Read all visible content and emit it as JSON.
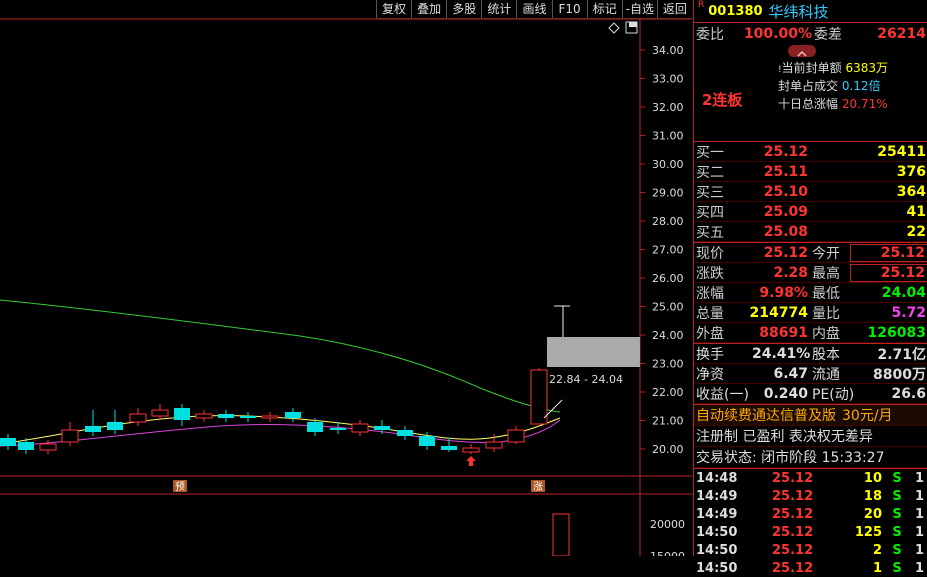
{
  "toolbar": [
    "复权",
    "叠加",
    "多股",
    "统计",
    "画线",
    "F10",
    "标记",
    "-自选",
    "返回"
  ],
  "chart": {
    "price_axis": [
      "34.00",
      "33.00",
      "32.00",
      "31.00",
      "30.00",
      "29.00",
      "28.00",
      "27.00",
      "26.00",
      "25.00",
      "24.00",
      "23.00",
      "22.00",
      "21.00",
      "20.00"
    ],
    "range_label": "22.84 - 24.04",
    "marker_yu": "预",
    "marker_zhang": "涨",
    "volume_axis": [
      "20000",
      "15000"
    ]
  },
  "stock": {
    "r_badge": "R",
    "code": "001380",
    "name": "华纬科技"
  },
  "weibi": {
    "label": "委比",
    "pct": "100.00%",
    "diff_label": "委差",
    "diff": "26214"
  },
  "seal": {
    "line1_label": "当前封单额",
    "line1_value": "6383万",
    "line2_label": "封单占成交",
    "line2_value": "0.12倍",
    "line3_label": "十日总涨幅",
    "line3_value": "20.71%",
    "lianban": "2连板"
  },
  "bids": [
    {
      "label": "买一",
      "price": "25.12",
      "vol": "25411"
    },
    {
      "label": "买二",
      "price": "25.11",
      "vol": "376"
    },
    {
      "label": "买三",
      "price": "25.10",
      "vol": "364"
    },
    {
      "label": "买四",
      "price": "25.09",
      "vol": "41"
    },
    {
      "label": "买五",
      "price": "25.08",
      "vol": "22"
    }
  ],
  "quote": [
    {
      "l1": "现价",
      "v1": "25.12",
      "l2": "今开",
      "v2": "25.12"
    },
    {
      "l1": "涨跌",
      "v1": "2.28",
      "l2": "最高",
      "v2": "25.12"
    },
    {
      "l1": "涨幅",
      "v1": "9.98%",
      "l2": "最低",
      "v2": "24.04"
    },
    {
      "l1": "总量",
      "v1": "214774",
      "l2": "量比",
      "v2": "5.72"
    },
    {
      "l1": "外盘",
      "v1": "88691",
      "l2": "内盘",
      "v2": "126083"
    }
  ],
  "fund": [
    {
      "l1": "换手",
      "v1": "24.41%",
      "l2": "股本",
      "v2": "2.71亿"
    },
    {
      "l1": "净资",
      "v1": "6.47",
      "l2": "流通",
      "v2": "8800万"
    },
    {
      "l1": "收益(一)",
      "v1": "0.240",
      "l2": "PE(动)",
      "v2": "26.6"
    }
  ],
  "promo": {
    "text": "自动续费通达信普及版",
    "price": "30元/月"
  },
  "reg": "注册制 已盈利 表决权无差异",
  "status": "交易状态: 闭市阶段 15:33:27",
  "ticks": [
    {
      "time": "14:48",
      "price": "25.12",
      "vol": "10",
      "side": "S",
      "n": "1"
    },
    {
      "time": "14:49",
      "price": "25.12",
      "vol": "18",
      "side": "S",
      "n": "1"
    },
    {
      "time": "14:49",
      "price": "25.12",
      "vol": "20",
      "side": "S",
      "n": "1"
    },
    {
      "time": "14:50",
      "price": "25.12",
      "vol": "125",
      "side": "S",
      "n": "1"
    },
    {
      "time": "14:50",
      "price": "25.12",
      "vol": "2",
      "side": "S",
      "n": "1"
    },
    {
      "time": "14:50",
      "price": "25.12",
      "vol": "1",
      "side": "S",
      "n": "1"
    }
  ],
  "colors": {
    "up": "#ff3333",
    "down": "#00e0e0",
    "ma_green": "#33cc33",
    "ma_yellow": "#ffff66",
    "ma_magenta": "#dd44dd",
    "accent_red": "#bb2222"
  }
}
